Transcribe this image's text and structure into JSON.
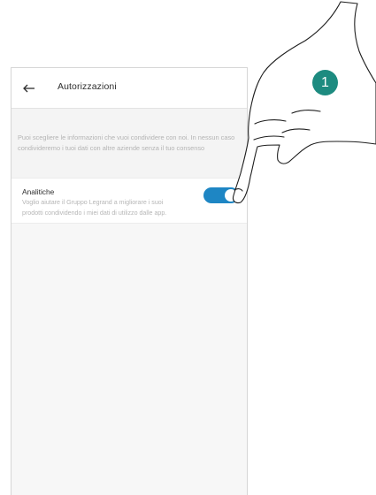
{
  "header": {
    "back_icon": "arrow-left-icon",
    "title": "Autorizzazioni"
  },
  "intro": {
    "text": "Puoi scegliere le informazioni che vuoi condividere con noi. In nessun caso condivideremo i tuoi dati con altre aziende senza il tuo consenso"
  },
  "analytics": {
    "title": "Analitiche",
    "description": "Voglio aiutare il Gruppo Legrand a migliorare i suoi prodotti condividendo i miei dati di utilizzo dalle app.",
    "enabled": true
  },
  "instruction": {
    "step_number": "1",
    "pointer_icon": "pointing-hand-icon"
  },
  "colors": {
    "toggle_on": "#1e86c4",
    "badge": "#1d8b80",
    "muted_text": "#b4b4b4"
  }
}
